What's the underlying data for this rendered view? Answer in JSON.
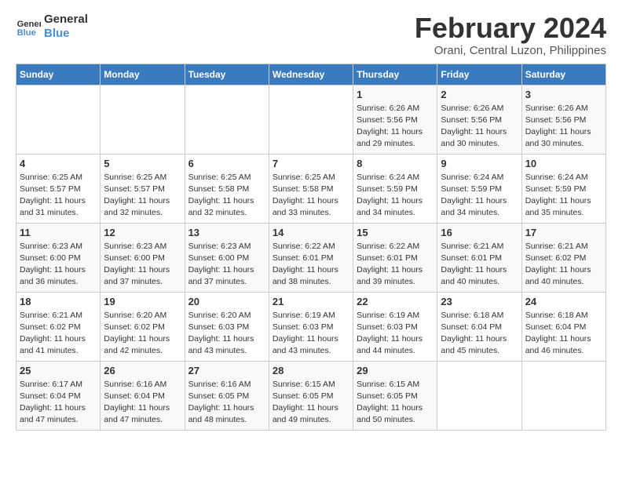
{
  "logo": {
    "text_general": "General",
    "text_blue": "Blue"
  },
  "header": {
    "month_year": "February 2024",
    "location": "Orani, Central Luzon, Philippines"
  },
  "days_of_week": [
    "Sunday",
    "Monday",
    "Tuesday",
    "Wednesday",
    "Thursday",
    "Friday",
    "Saturday"
  ],
  "weeks": [
    [
      {
        "day": "",
        "info": ""
      },
      {
        "day": "",
        "info": ""
      },
      {
        "day": "",
        "info": ""
      },
      {
        "day": "",
        "info": ""
      },
      {
        "day": "1",
        "info": "Sunrise: 6:26 AM\nSunset: 5:56 PM\nDaylight: 11 hours and 29 minutes."
      },
      {
        "day": "2",
        "info": "Sunrise: 6:26 AM\nSunset: 5:56 PM\nDaylight: 11 hours and 30 minutes."
      },
      {
        "day": "3",
        "info": "Sunrise: 6:26 AM\nSunset: 5:56 PM\nDaylight: 11 hours and 30 minutes."
      }
    ],
    [
      {
        "day": "4",
        "info": "Sunrise: 6:25 AM\nSunset: 5:57 PM\nDaylight: 11 hours and 31 minutes."
      },
      {
        "day": "5",
        "info": "Sunrise: 6:25 AM\nSunset: 5:57 PM\nDaylight: 11 hours and 32 minutes."
      },
      {
        "day": "6",
        "info": "Sunrise: 6:25 AM\nSunset: 5:58 PM\nDaylight: 11 hours and 32 minutes."
      },
      {
        "day": "7",
        "info": "Sunrise: 6:25 AM\nSunset: 5:58 PM\nDaylight: 11 hours and 33 minutes."
      },
      {
        "day": "8",
        "info": "Sunrise: 6:24 AM\nSunset: 5:59 PM\nDaylight: 11 hours and 34 minutes."
      },
      {
        "day": "9",
        "info": "Sunrise: 6:24 AM\nSunset: 5:59 PM\nDaylight: 11 hours and 34 minutes."
      },
      {
        "day": "10",
        "info": "Sunrise: 6:24 AM\nSunset: 5:59 PM\nDaylight: 11 hours and 35 minutes."
      }
    ],
    [
      {
        "day": "11",
        "info": "Sunrise: 6:23 AM\nSunset: 6:00 PM\nDaylight: 11 hours and 36 minutes."
      },
      {
        "day": "12",
        "info": "Sunrise: 6:23 AM\nSunset: 6:00 PM\nDaylight: 11 hours and 37 minutes."
      },
      {
        "day": "13",
        "info": "Sunrise: 6:23 AM\nSunset: 6:00 PM\nDaylight: 11 hours and 37 minutes."
      },
      {
        "day": "14",
        "info": "Sunrise: 6:22 AM\nSunset: 6:01 PM\nDaylight: 11 hours and 38 minutes."
      },
      {
        "day": "15",
        "info": "Sunrise: 6:22 AM\nSunset: 6:01 PM\nDaylight: 11 hours and 39 minutes."
      },
      {
        "day": "16",
        "info": "Sunrise: 6:21 AM\nSunset: 6:01 PM\nDaylight: 11 hours and 40 minutes."
      },
      {
        "day": "17",
        "info": "Sunrise: 6:21 AM\nSunset: 6:02 PM\nDaylight: 11 hours and 40 minutes."
      }
    ],
    [
      {
        "day": "18",
        "info": "Sunrise: 6:21 AM\nSunset: 6:02 PM\nDaylight: 11 hours and 41 minutes."
      },
      {
        "day": "19",
        "info": "Sunrise: 6:20 AM\nSunset: 6:02 PM\nDaylight: 11 hours and 42 minutes."
      },
      {
        "day": "20",
        "info": "Sunrise: 6:20 AM\nSunset: 6:03 PM\nDaylight: 11 hours and 43 minutes."
      },
      {
        "day": "21",
        "info": "Sunrise: 6:19 AM\nSunset: 6:03 PM\nDaylight: 11 hours and 43 minutes."
      },
      {
        "day": "22",
        "info": "Sunrise: 6:19 AM\nSunset: 6:03 PM\nDaylight: 11 hours and 44 minutes."
      },
      {
        "day": "23",
        "info": "Sunrise: 6:18 AM\nSunset: 6:04 PM\nDaylight: 11 hours and 45 minutes."
      },
      {
        "day": "24",
        "info": "Sunrise: 6:18 AM\nSunset: 6:04 PM\nDaylight: 11 hours and 46 minutes."
      }
    ],
    [
      {
        "day": "25",
        "info": "Sunrise: 6:17 AM\nSunset: 6:04 PM\nDaylight: 11 hours and 47 minutes."
      },
      {
        "day": "26",
        "info": "Sunrise: 6:16 AM\nSunset: 6:04 PM\nDaylight: 11 hours and 47 minutes."
      },
      {
        "day": "27",
        "info": "Sunrise: 6:16 AM\nSunset: 6:05 PM\nDaylight: 11 hours and 48 minutes."
      },
      {
        "day": "28",
        "info": "Sunrise: 6:15 AM\nSunset: 6:05 PM\nDaylight: 11 hours and 49 minutes."
      },
      {
        "day": "29",
        "info": "Sunrise: 6:15 AM\nSunset: 6:05 PM\nDaylight: 11 hours and 50 minutes."
      },
      {
        "day": "",
        "info": ""
      },
      {
        "day": "",
        "info": ""
      }
    ]
  ]
}
